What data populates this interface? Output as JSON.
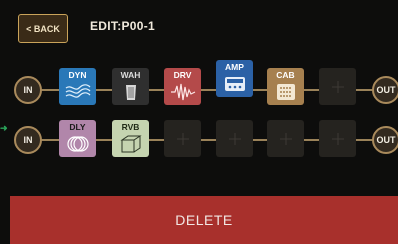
{
  "header": {
    "back_label": "< BACK",
    "title": "EDIT:P00-1"
  },
  "chains": [
    {
      "in_label": "IN",
      "out_label": "OUT",
      "blocks": [
        {
          "label": "DYN",
          "icon": "dyn-wave-icon",
          "color": "#2a78b8",
          "empty": false
        },
        {
          "label": "WAH",
          "icon": "wah-pedal-icon",
          "color": "#2f2f2f",
          "empty": false
        },
        {
          "label": "DRV",
          "icon": "drv-wave-icon",
          "color": "#b44a4a",
          "empty": false
        },
        {
          "label": "AMP",
          "icon": "amp-icon",
          "color": "#2b61a6",
          "empty": false
        },
        {
          "label": "CAB",
          "icon": "cab-icon",
          "color": "#a6804f",
          "empty": false
        },
        {
          "label": "",
          "icon": "plus-icon",
          "empty": true
        }
      ]
    },
    {
      "in_label": "IN",
      "out_label": "OUT",
      "blocks": [
        {
          "label": "DLY",
          "icon": "dly-circles-icon",
          "color": "#b186aa",
          "empty": false
        },
        {
          "label": "RVB",
          "icon": "rvb-room-icon",
          "color": "#c5d4b0",
          "empty": false
        },
        {
          "label": "",
          "icon": "plus-icon",
          "empty": true
        },
        {
          "label": "",
          "icon": "plus-icon",
          "empty": true
        },
        {
          "label": "",
          "icon": "plus-icon",
          "empty": true
        },
        {
          "label": "",
          "icon": "plus-icon",
          "empty": true
        }
      ]
    }
  ],
  "delete_label": "DELETE"
}
